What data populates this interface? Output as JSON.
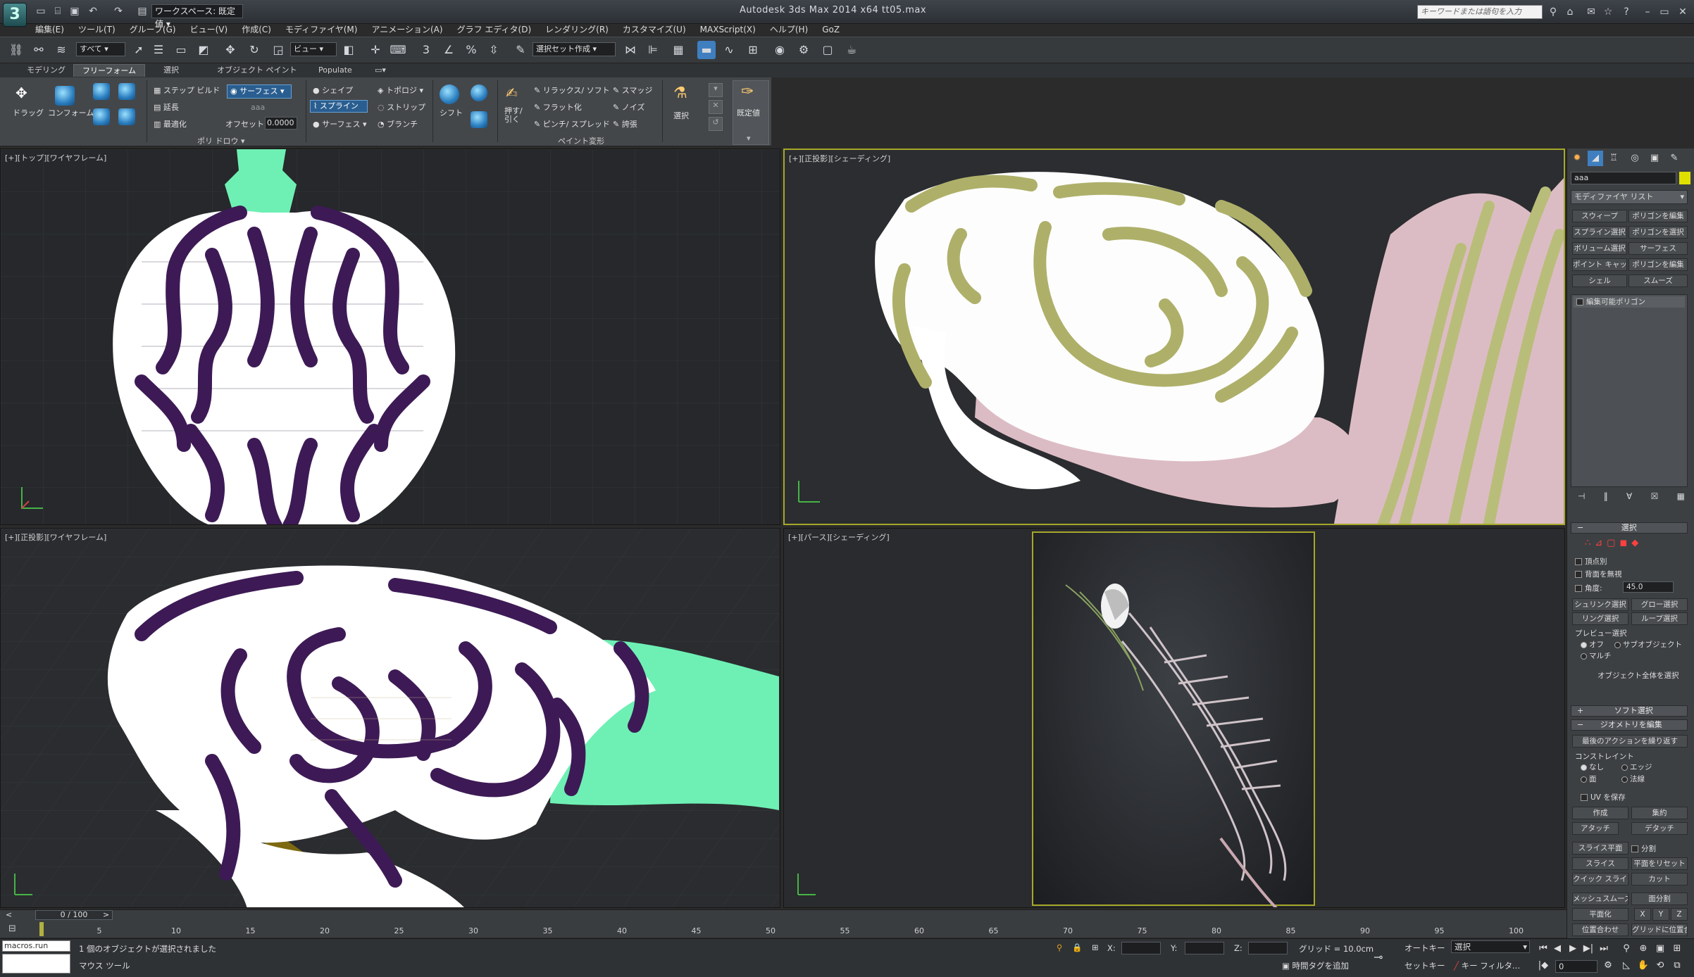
{
  "app": {
    "title": "Autodesk 3ds Max  2014 x64       tt05.max",
    "workspace": "ワークスペース: 既定値",
    "search_placeholder": "キーワードまたは語句を入力"
  },
  "menu": [
    "編集(E)",
    "ツール(T)",
    "グループ(G)",
    "ビュー(V)",
    "作成(C)",
    "モディファイヤ(M)",
    "アニメーション(A)",
    "グラフ エディタ(D)",
    "レンダリング(R)",
    "カスタマイズ(U)",
    "MAXScript(X)",
    "ヘルプ(H)",
    "GoZ"
  ],
  "toolbar": {
    "filter": "すべて",
    "refcoord": "ビュー",
    "selset": "選択セット作成"
  },
  "ribbon": {
    "tabs": [
      "モデリング",
      "フリーフォーム",
      "選択",
      "オブジェクト ペイント",
      "Populate"
    ],
    "drag": "ドラッグ",
    "conform": "コンフォーム",
    "step_build": "ステップ ビルド",
    "extend": "延長",
    "optimize": "最適化",
    "surface_btn": "サーフェス",
    "aaa": "aaa",
    "offset_label": "オフセット:",
    "offset_value": "0.0000",
    "shape": "シェイプ",
    "spline": "スプライン",
    "surface2": "サーフェス",
    "topology": "トポロジ",
    "strip": "ストリップ",
    "branch": "ブランチ",
    "shift": "シフト",
    "push_pull": "押す/引く",
    "relax_soft": "リラックス/ ソフト",
    "flatten": "フラット化",
    "pinch_spread": "ピンチ/ スプレッド",
    "smudge": "スマッジ",
    "noise": "ノイズ",
    "exaggerate": "誇張",
    "select": "選択",
    "defaults": "既定値",
    "polydraw": "ポリ ドロウ",
    "paint_deform": "ペイント変形"
  },
  "viewports": {
    "top": "[+][トップ][ワイヤフレーム]",
    "front": "[+][正投影][シェーディング]",
    "left": "[+][正投影][ワイヤフレーム]",
    "persp": "[+][パース][シェーディング]"
  },
  "command_panel": {
    "object_name": "aaa",
    "modifier_list": "モディファイヤ リスト",
    "buttons": [
      [
        "スウィープ",
        "ポリゴンを編集"
      ],
      [
        "スプライン選択",
        "ポリゴンを選択"
      ],
      [
        "ボリューム選択",
        "サーフェス"
      ],
      [
        "ポイント キャッシュ",
        "ポリゴンを編集"
      ],
      [
        "シェル",
        "スムーズ"
      ]
    ],
    "stack_item": "編集可能ポリゴン",
    "selection": "選択",
    "by_vertex": "頂点別",
    "ignore_backface": "背面を無視",
    "angle": "角度:",
    "angle_value": "45.0",
    "shrink": "シュリンク選択",
    "grow": "グロー選択",
    "ring": "リング選択",
    "loop": "ループ選択",
    "preview": "プレビュー選択",
    "off": "オフ",
    "subobject": "サブオブジェクト",
    "multi": "マルチ",
    "whole_object": "オブジェクト全体を選択",
    "soft_selection": "ソフト選択",
    "edit_geometry": "ジオメトリを編集",
    "repeat_last": "最後のアクションを繰り返す",
    "constraints": "コンストレイント",
    "none": "なし",
    "edge": "エッジ",
    "face": "面",
    "normal": "法線",
    "preserve_uv": "UV を保存",
    "create": "作成",
    "collapse": "集約",
    "attach": "アタッチ",
    "detach": "デタッチ",
    "slice_plane": "スライス平面",
    "split": "分割",
    "slice": "スライス",
    "reset_plane": "平面をリセット",
    "quickslice": "クイック スライス",
    "cut": "カット",
    "meshsmooth": "メッシュスムーズ",
    "tessellate": "面分割",
    "make_planar": "平面化",
    "xyz": [
      "X",
      "Y",
      "Z"
    ],
    "view_align": "位置合わせ",
    "grid_align": "グリッドに位置合わせ"
  },
  "timeline": {
    "slider": "0 / 100",
    "ticks": [
      "5",
      "10",
      "15",
      "20",
      "25",
      "30",
      "35",
      "40",
      "45",
      "50",
      "55",
      "60",
      "65",
      "70",
      "75",
      "80",
      "85",
      "90",
      "95",
      "100"
    ]
  },
  "status": {
    "maxscript": "macros.run \"Poly",
    "message": "1 個のオブジェクトが選択されました",
    "prompt": "マウス ツール",
    "x_label": "X:",
    "y_label": "Y:",
    "z_label": "Z:",
    "grid": "グリッド = 10.0cm",
    "add_time_tag": "時間タグを追加",
    "autokey": "オートキー",
    "setkey": "セットキー",
    "selected": "選択",
    "key_filters": "キー フィルタ...",
    "frame": "0"
  }
}
